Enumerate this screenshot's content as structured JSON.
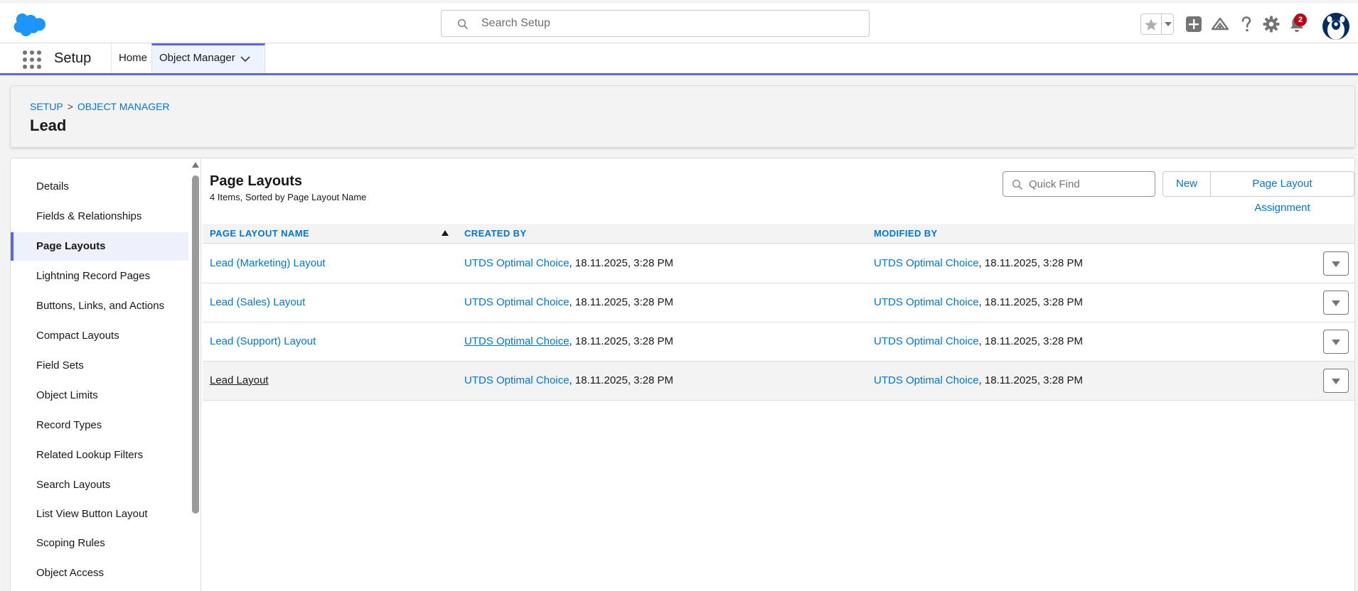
{
  "header": {
    "search_placeholder": "Search Setup",
    "notification_count": "2",
    "icons": [
      "salesforce-cloud-logo",
      "search-icon",
      "star-icon",
      "chevron-down-icon",
      "add-icon",
      "trailhead-icon",
      "help-icon",
      "gear-icon",
      "bell-icon",
      "avatar"
    ],
    "brand_color": "#1b96ff"
  },
  "nav": {
    "app_name": "Setup",
    "tabs": [
      {
        "label": "Home"
      },
      {
        "label": "Object Manager"
      }
    ]
  },
  "page": {
    "breadcrumb": [
      "SETUP",
      "OBJECT MANAGER"
    ],
    "breadcrumb_sep": ">",
    "title": "Lead"
  },
  "sidebar": {
    "items": [
      {
        "label": "Details"
      },
      {
        "label": "Fields & Relationships"
      },
      {
        "label": "Page Layouts"
      },
      {
        "label": "Lightning Record Pages"
      },
      {
        "label": "Buttons, Links, and Actions"
      },
      {
        "label": "Compact Layouts"
      },
      {
        "label": "Field Sets"
      },
      {
        "label": "Object Limits"
      },
      {
        "label": "Record Types"
      },
      {
        "label": "Related Lookup Filters"
      },
      {
        "label": "Search Layouts"
      },
      {
        "label": "List View Button Layout"
      },
      {
        "label": "Scoping Rules"
      },
      {
        "label": "Object Access"
      }
    ],
    "active": "Page Layouts"
  },
  "list": {
    "title": "Page Layouts",
    "subtitle": "4 Items, Sorted by Page Layout Name",
    "quick_find_placeholder": "Quick Find",
    "new_label": "New",
    "assign_label": "Page Layout Assignment",
    "columns": [
      "Page Layout Name",
      "Created By",
      "Modified By"
    ],
    "rows": [
      {
        "name": "Lead (Marketing) Layout",
        "created_by": "UTDS Optimal Choice",
        "created_at": ", 18.11.2025, 3:28 PM",
        "modified_by": "UTDS Optimal Choice",
        "modified_at": ", 18.11.2025, 3:28 PM"
      },
      {
        "name": "Lead (Sales) Layout",
        "created_by": "UTDS Optimal Choice",
        "created_at": ", 18.11.2025, 3:28 PM",
        "modified_by": "UTDS Optimal Choice",
        "modified_at": ", 18.11.2025, 3:28 PM"
      },
      {
        "name": "Lead (Support) Layout",
        "created_by": "UTDS Optimal Choice",
        "created_at": ", 18.11.2025, 3:28 PM",
        "modified_by": "UTDS Optimal Choice",
        "modified_at": ", 18.11.2025, 3:28 PM"
      },
      {
        "name": "Lead Layout",
        "created_by": "UTDS Optimal Choice",
        "created_at": ", 18.11.2025, 3:28 PM",
        "modified_by": "UTDS Optimal Choice",
        "modified_at": ", 18.11.2025, 3:28 PM"
      }
    ]
  }
}
